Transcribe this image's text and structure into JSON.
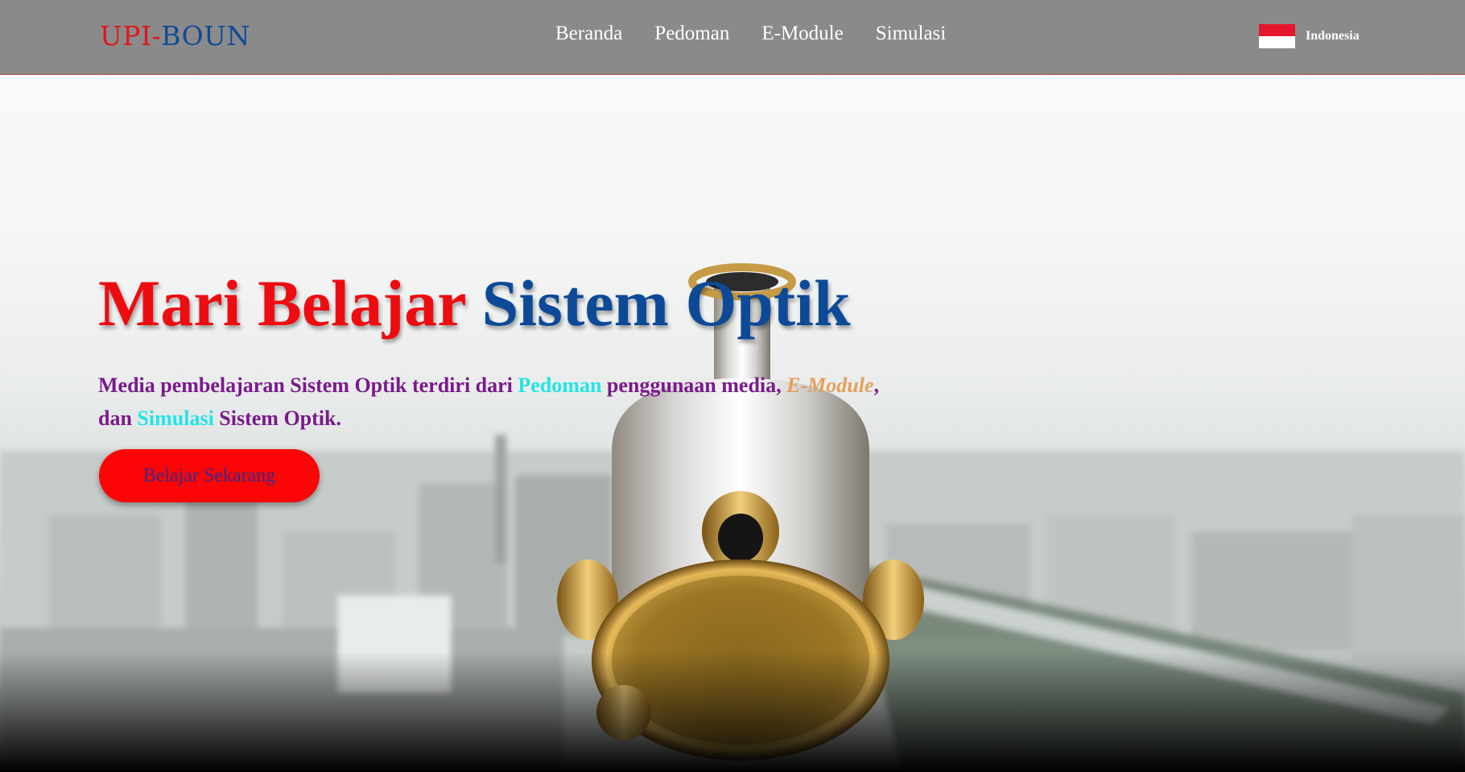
{
  "logo": {
    "part1": "UPI",
    "separator": "-",
    "part2": "BOUN"
  },
  "nav": {
    "items": [
      {
        "label": "Beranda"
      },
      {
        "label": "Pedoman"
      },
      {
        "label": "E-Module"
      },
      {
        "label": "Simulasi"
      }
    ]
  },
  "language": {
    "label": "Indonesia",
    "flag_icon": "indonesia-flag-icon"
  },
  "hero": {
    "title_part1": "Mari Belajar",
    "title_part2": "Sistem Optik",
    "desc": {
      "s1": "Media pembelajaran Sistem Optik terdiri dari ",
      "link1": "Pedoman",
      "s2": " penggunaan media, ",
      "link2": "E-Module",
      "s3": ",",
      "s4": "dan ",
      "link3": "Simulasi",
      "s5": " Sistem Optik."
    },
    "cta_label": "Belajar Sekarang"
  },
  "colors": {
    "navbar_bg": "#8a8a8a",
    "accent_red": "#fb0506",
    "accent_blue": "#0c4a98",
    "desc_purple": "#7a1a8c",
    "link_cyan": "#22e5e5",
    "link_orange": "#e3a15c"
  }
}
